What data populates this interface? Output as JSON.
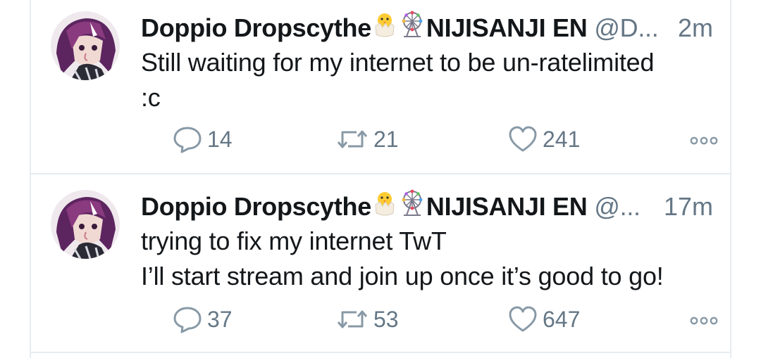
{
  "tweets": [
    {
      "author": "Doppio Dropscythe",
      "emoji_1": "hatching-chick-emoji",
      "emoji_2": "ferris-wheel-emoji",
      "org": "NIJISANJI EN",
      "handle": "@D...",
      "time": "2m",
      "text_lines": [
        "Still waiting for my internet to be un-ratelimited",
        ":c"
      ],
      "replies": "14",
      "retweets": "21",
      "likes": "241"
    },
    {
      "author": "Doppio Dropscythe",
      "emoji_1": "hatching-chick-emoji",
      "emoji_2": "ferris-wheel-emoji",
      "org": "NIJISANJI EN",
      "handle": "@...",
      "time": "17m",
      "text_lines": [
        "trying to fix my internet TwT",
        "I’ll start stream and join up once it’s good to go!"
      ],
      "replies": "37",
      "retweets": "53",
      "likes": "647"
    }
  ],
  "icons": {
    "reply": "reply-icon",
    "retweet": "retweet-icon",
    "like": "heart-icon",
    "more": "more-options-icon"
  },
  "colors": {
    "text": "#14171a",
    "secondary": "#657786",
    "divider": "#e6ecf0",
    "avatar_hair": "#6a2a66"
  }
}
